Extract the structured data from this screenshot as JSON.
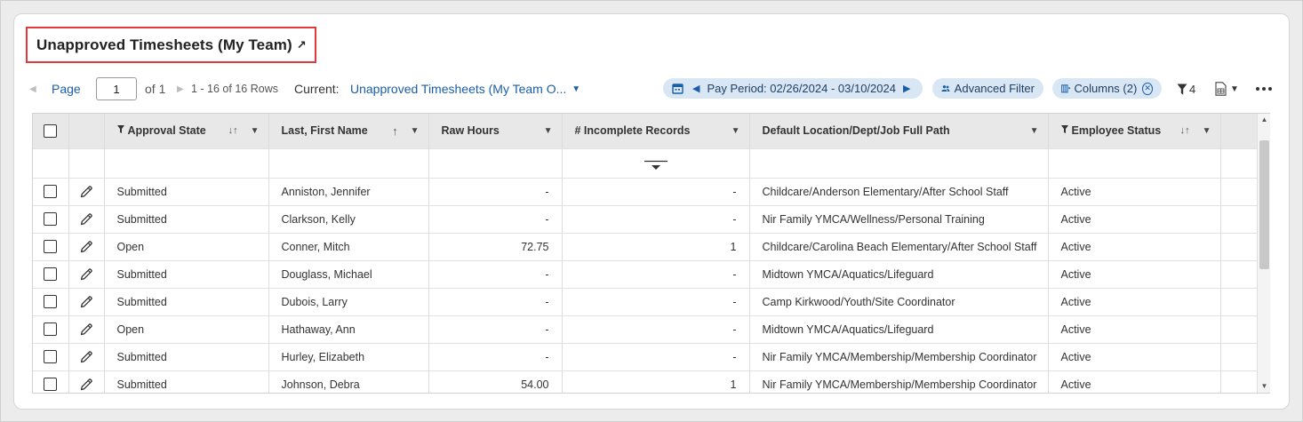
{
  "widget": {
    "title": "Unapproved Timesheets (My Team)",
    "external_icon": "↗"
  },
  "toolbar": {
    "page_label": "Page",
    "page_value": "1",
    "of_label": "of 1",
    "rows_summary": "1 - 16 of 16 Rows",
    "current_label": "Current:",
    "current_view": "Unapproved Timesheets (My Team O...",
    "pay_period": "Pay Period: 02/26/2024 - 03/10/2024",
    "advanced_filter": "Advanced Filter",
    "columns_label": "Columns (2)",
    "filter_count": "4"
  },
  "columns": [
    {
      "label": "Approval State",
      "filtered": true,
      "sort": "sortable"
    },
    {
      "label": "Last, First Name",
      "filtered": false,
      "sort": "asc"
    },
    {
      "label": "Raw Hours",
      "filtered": false,
      "sort": "none"
    },
    {
      "label": "# Incomplete Records",
      "filtered": false,
      "sort": "none"
    },
    {
      "label": "Default Location/Dept/Job Full Path",
      "filtered": false,
      "sort": "none"
    },
    {
      "label": "Employee Status",
      "filtered": true,
      "sort": "sortable"
    }
  ],
  "rows": [
    {
      "state": "Submitted",
      "name": "Anniston, Jennifer",
      "hours": "-",
      "incomplete": "-",
      "path": "Childcare/Anderson Elementary/After School Staff",
      "status": "Active"
    },
    {
      "state": "Submitted",
      "name": "Clarkson, Kelly",
      "hours": "-",
      "incomplete": "-",
      "path": "Nir Family YMCA/Wellness/Personal Training",
      "status": "Active"
    },
    {
      "state": "Open",
      "name": "Conner, Mitch",
      "hours": "72.75",
      "incomplete": "1",
      "path": "Childcare/Carolina Beach Elementary/After School Staff",
      "status": "Active"
    },
    {
      "state": "Submitted",
      "name": "Douglass, Michael",
      "hours": "-",
      "incomplete": "-",
      "path": "Midtown YMCA/Aquatics/Lifeguard",
      "status": "Active"
    },
    {
      "state": "Submitted",
      "name": "Dubois, Larry",
      "hours": "-",
      "incomplete": "-",
      "path": "Camp Kirkwood/Youth/Site Coordinator",
      "status": "Active"
    },
    {
      "state": "Open",
      "name": "Hathaway, Ann",
      "hours": "-",
      "incomplete": "-",
      "path": "Midtown YMCA/Aquatics/Lifeguard",
      "status": "Active"
    },
    {
      "state": "Submitted",
      "name": "Hurley, Elizabeth",
      "hours": "-",
      "incomplete": "-",
      "path": "Nir Family YMCA/Membership/Membership Coordinator",
      "status": "Active"
    },
    {
      "state": "Submitted",
      "name": "Johnson, Debra",
      "hours": "54.00",
      "incomplete": "1",
      "path": "Nir Family YMCA/Membership/Membership Coordinator",
      "status": "Active"
    }
  ],
  "colors": {
    "accent": "#1a5ea8",
    "pill_bg": "#d9e7f5",
    "highlight_border": "#e03a3a",
    "header_bg": "#e8e8e8"
  }
}
